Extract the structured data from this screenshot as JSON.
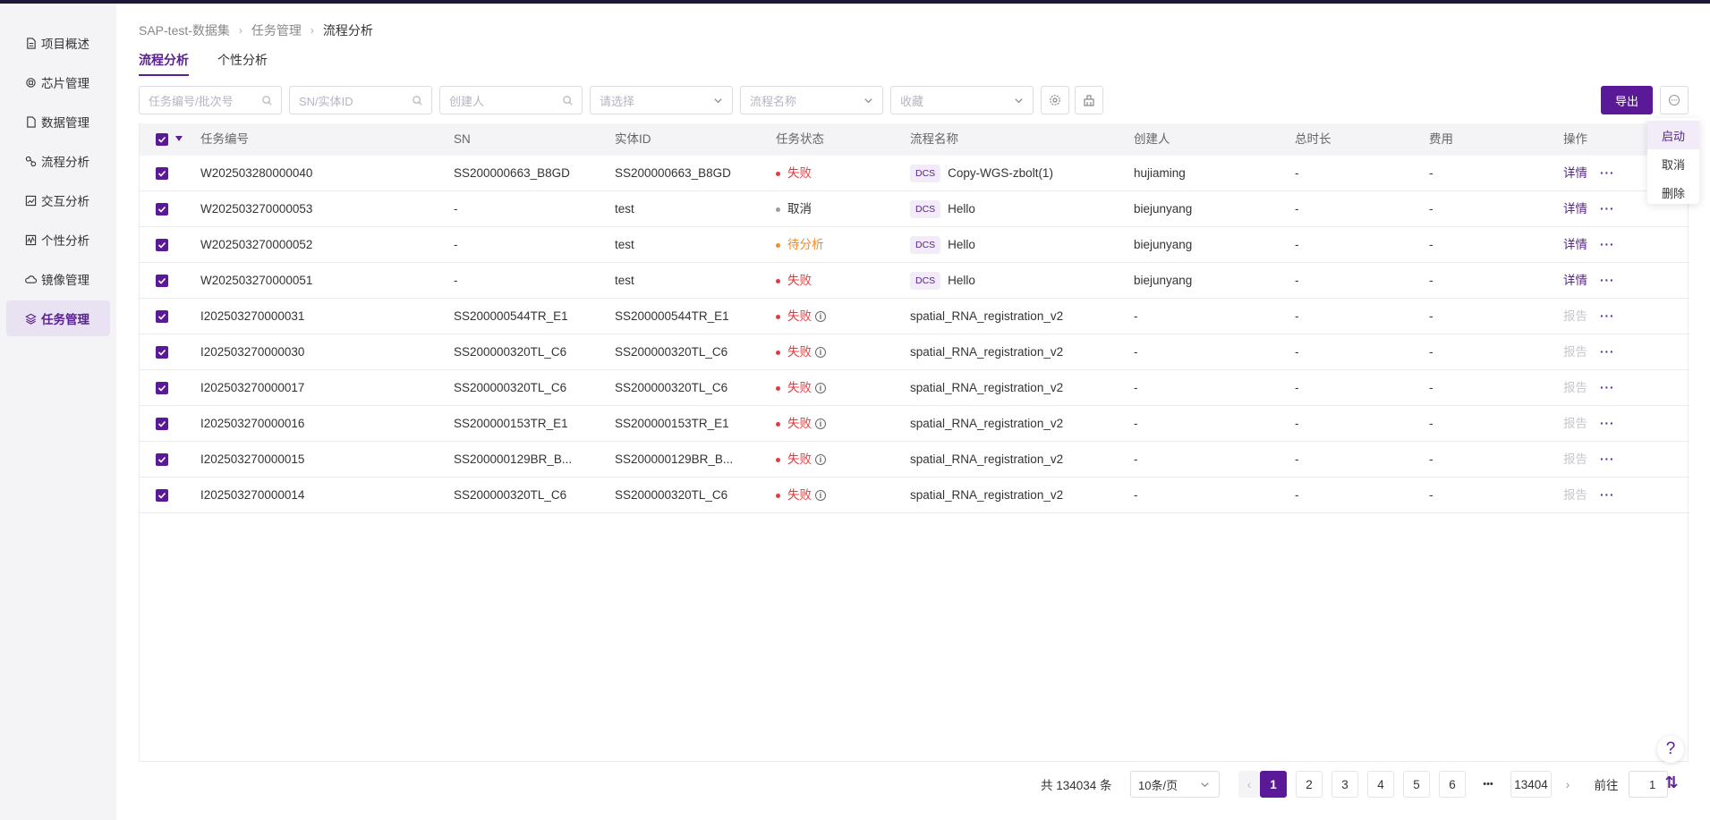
{
  "sidebar": {
    "items": [
      {
        "label": "项目概述",
        "icon": "document-icon"
      },
      {
        "label": "芯片管理",
        "icon": "chip-icon"
      },
      {
        "label": "数据管理",
        "icon": "file-icon"
      },
      {
        "label": "流程分析",
        "icon": "flow-icon"
      },
      {
        "label": "交互分析",
        "icon": "chart-icon"
      },
      {
        "label": "个性分析",
        "icon": "line-chart-icon"
      },
      {
        "label": "镜像管理",
        "icon": "cloud-icon"
      },
      {
        "label": "任务管理",
        "icon": "layers-icon",
        "active": true
      }
    ]
  },
  "breadcrumb": [
    "SAP-test-数据集",
    "任务管理",
    "流程分析"
  ],
  "tabs": [
    "流程分析",
    "个性分析"
  ],
  "filters": {
    "task_no": "任务编号/批次号",
    "sn": "SN/实体ID",
    "creator": "创建人",
    "status": "请选择",
    "flow": "流程名称",
    "favorite": "收藏"
  },
  "toolbar": {
    "export_label": "导出"
  },
  "dropdown": [
    "启动",
    "取消",
    "删除"
  ],
  "table": {
    "headers": [
      "任务编号",
      "SN",
      "实体ID",
      "任务状态",
      "流程名称",
      "创建人",
      "总时长",
      "费用",
      "操作"
    ],
    "rows": [
      {
        "id": "W202503280000040",
        "sn": "SS200000663_B8GD",
        "entity": "SS200000663_B8GD",
        "status": "失败",
        "status_color": "#e5383b",
        "info": false,
        "tag": "DCS",
        "flow": "Copy-WGS-zbolt(1)",
        "creator": "hujiaming",
        "duration": "-",
        "cost": "-",
        "action": "详情",
        "action_enabled": true
      },
      {
        "id": "W202503270000053",
        "sn": "-",
        "entity": "test",
        "status": "取消",
        "status_color": "#9a9aa3",
        "info": false,
        "tag": "DCS",
        "flow": "Hello",
        "creator": "biejunyang",
        "duration": "-",
        "cost": "-",
        "action": "详情",
        "action_enabled": true
      },
      {
        "id": "W202503270000052",
        "sn": "-",
        "entity": "test",
        "status": "待分析",
        "status_color": "#f08c2a",
        "info": false,
        "tag": "DCS",
        "flow": "Hello",
        "creator": "biejunyang",
        "duration": "-",
        "cost": "-",
        "action": "详情",
        "action_enabled": true
      },
      {
        "id": "W202503270000051",
        "sn": "-",
        "entity": "test",
        "status": "失败",
        "status_color": "#e5383b",
        "info": false,
        "tag": "DCS",
        "flow": "Hello",
        "creator": "biejunyang",
        "duration": "-",
        "cost": "-",
        "action": "详情",
        "action_enabled": true
      },
      {
        "id": "I202503270000031",
        "sn": "SS200000544TR_E1",
        "entity": "SS200000544TR_E1",
        "status": "失败",
        "status_color": "#e5383b",
        "info": true,
        "tag": "",
        "flow": "spatial_RNA_registration_v2",
        "creator": "-",
        "duration": "-",
        "cost": "-",
        "action": "报告",
        "action_enabled": false
      },
      {
        "id": "I202503270000030",
        "sn": "SS200000320TL_C6",
        "entity": "SS200000320TL_C6",
        "status": "失败",
        "status_color": "#e5383b",
        "info": true,
        "tag": "",
        "flow": "spatial_RNA_registration_v2",
        "creator": "-",
        "duration": "-",
        "cost": "-",
        "action": "报告",
        "action_enabled": false
      },
      {
        "id": "I202503270000017",
        "sn": "SS200000320TL_C6",
        "entity": "SS200000320TL_C6",
        "status": "失败",
        "status_color": "#e5383b",
        "info": true,
        "tag": "",
        "flow": "spatial_RNA_registration_v2",
        "creator": "-",
        "duration": "-",
        "cost": "-",
        "action": "报告",
        "action_enabled": false
      },
      {
        "id": "I202503270000016",
        "sn": "SS200000153TR_E1",
        "entity": "SS200000153TR_E1",
        "status": "失败",
        "status_color": "#e5383b",
        "info": true,
        "tag": "",
        "flow": "spatial_RNA_registration_v2",
        "creator": "-",
        "duration": "-",
        "cost": "-",
        "action": "报告",
        "action_enabled": false
      },
      {
        "id": "I202503270000015",
        "sn": "SS200000129BR_B...",
        "entity": "SS200000129BR_B...",
        "status": "失败",
        "status_color": "#e5383b",
        "info": true,
        "tag": "",
        "flow": "spatial_RNA_registration_v2",
        "creator": "-",
        "duration": "-",
        "cost": "-",
        "action": "报告",
        "action_enabled": false
      },
      {
        "id": "I202503270000014",
        "sn": "SS200000320TL_C6",
        "entity": "SS200000320TL_C6",
        "status": "失败",
        "status_color": "#e5383b",
        "info": true,
        "tag": "",
        "flow": "spatial_RNA_registration_v2",
        "creator": "-",
        "duration": "-",
        "cost": "-",
        "action": "报告",
        "action_enabled": false
      }
    ]
  },
  "pagination": {
    "total": "共 134034 条",
    "page_size": "10条/页",
    "pages": [
      "1",
      "2",
      "3",
      "4",
      "5",
      "6"
    ],
    "current": "1",
    "ellipsis": "•••",
    "last": "13404",
    "goto_label": "前往",
    "goto_value": "1"
  },
  "colors": {
    "accent": "#5a1a98",
    "fail": "#e5383b",
    "cancel": "#9a9aa3",
    "pending": "#f08c2a"
  }
}
